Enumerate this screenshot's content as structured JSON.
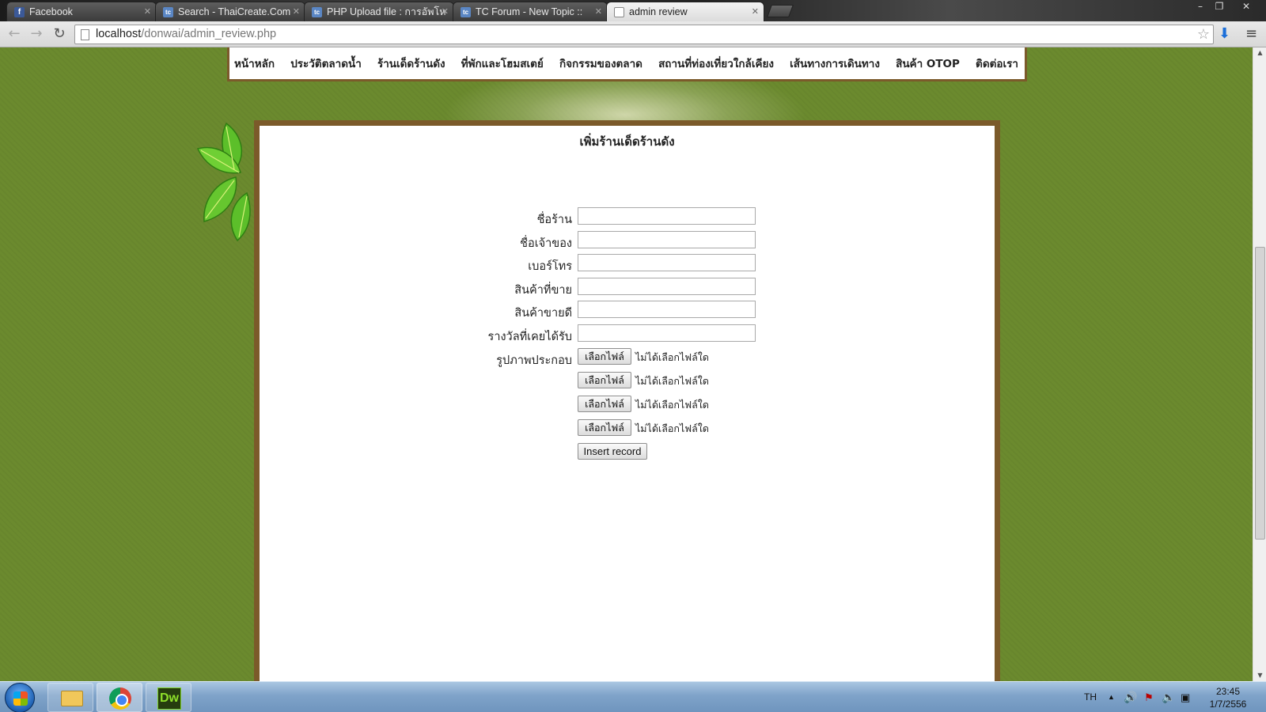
{
  "browser": {
    "tabs": [
      {
        "label": "Facebook",
        "favicon": "facebook-icon"
      },
      {
        "label": "Search - ThaiCreate.Com",
        "favicon": "thaicreate-icon"
      },
      {
        "label": "PHP Upload file : การอัพโห",
        "favicon": "thaicreate-icon"
      },
      {
        "label": "TC Forum - New Topic :: ",
        "favicon": "thaicreate-icon"
      },
      {
        "label": "admin review",
        "favicon": "page-icon",
        "active": true
      }
    ],
    "url_host": "localhost",
    "url_path": "/donwai/admin_review.php"
  },
  "site_nav": {
    "items": [
      "หน้าหลัก",
      "ประวัติตลาดน้ำ",
      "ร้านเด็ดร้านดัง",
      "ที่พักและโฮมสเตย์",
      "กิจกรรมของตลาด",
      "สถานที่ท่องเที่ยวใกล้เคียง",
      "เส้นทางการเดินทาง",
      "สินค้า OTOP",
      "ติดต่อเรา"
    ]
  },
  "form": {
    "title": "เพิ่มร้านเด็ดร้านดัง",
    "fields": {
      "shop_name_label": "ชื่อร้าน",
      "owner_label": "ชื่อเจ้าของ",
      "phone_label": "เบอร์โทร",
      "products_label": "สินค้าที่ขาย",
      "best_seller_label": "สินค้าขายดี",
      "awards_label": "รางวัลที่เคยได้รับ",
      "images_label": "รูปภาพประกอบ"
    },
    "file_button_label": "เลือกไฟล์",
    "file_status": "ไม่ได้เลือกไฟล์ใด",
    "submit_label": "Insert record"
  },
  "taskbar": {
    "language": "TH",
    "time": "23:45",
    "date": "1/7/2556",
    "apps": [
      "file-explorer-icon",
      "chrome-icon",
      "dreamweaver-icon"
    ],
    "dreamweaver_text": "Dw"
  },
  "colors": {
    "page_background": "#6b8a2e",
    "panel_border": "#7b5a2a"
  }
}
